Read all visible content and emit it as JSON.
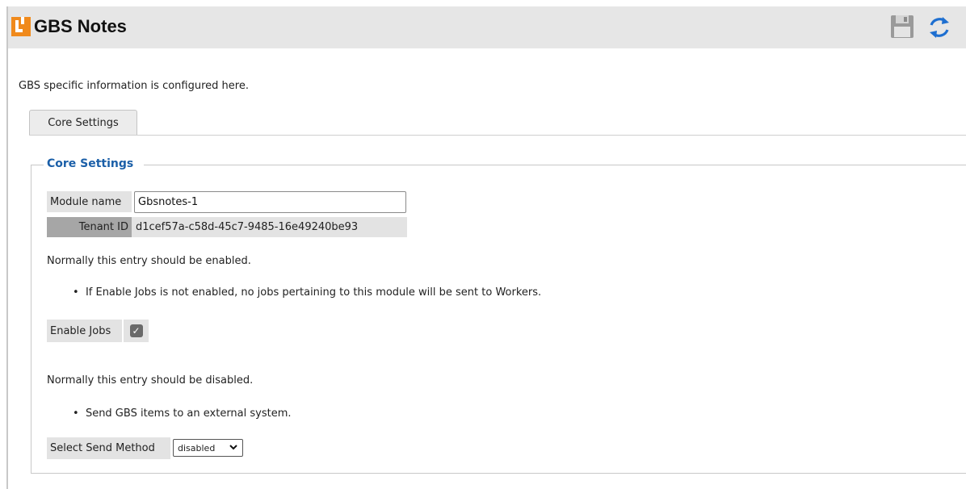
{
  "header": {
    "title": "GBS Notes",
    "save_icon": "save-icon",
    "refresh_icon": "refresh-icon"
  },
  "description": "GBS specific information is configured here.",
  "tabs": [
    {
      "label": "Core Settings",
      "active": true
    }
  ],
  "core_settings": {
    "legend": "Core Settings",
    "module_name_label": "Module name",
    "module_name_value": "Gbsnotes-1",
    "tenant_id_label": "Tenant ID",
    "tenant_id_value": "d1cef57a-c58d-45c7-9485-16e49240be93",
    "enable_note": "Normally this entry should be enabled.",
    "enable_bullet": "If Enable Jobs is not enabled, no jobs pertaining to this module will be sent to Workers.",
    "enable_jobs_label": "Enable Jobs",
    "enable_jobs_checked": true,
    "send_note": "Normally this entry should be disabled.",
    "send_bullet": "Send GBS items to an external system.",
    "send_method_label": "Select Send Method",
    "send_method_value": "disabled"
  },
  "colors": {
    "accent": "#f08a1c",
    "legend": "#1b5fa8",
    "refresh": "#1e6fd0",
    "header_bg": "#e6e6e6"
  }
}
